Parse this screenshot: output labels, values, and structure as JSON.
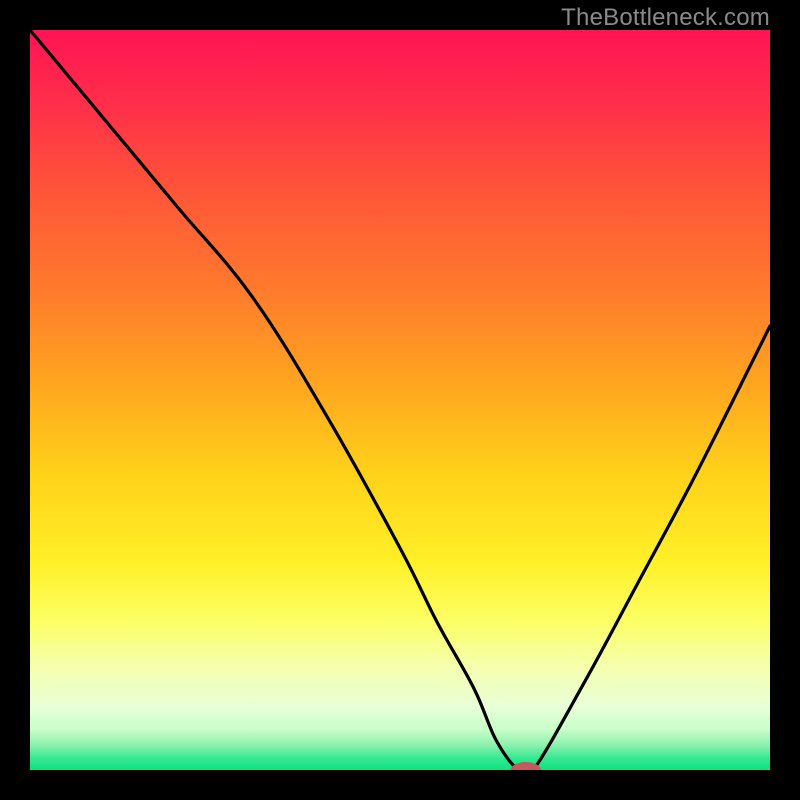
{
  "attribution": "TheBottleneck.com",
  "chart_data": {
    "type": "line",
    "title": "",
    "xlabel": "",
    "ylabel": "",
    "xlim": [
      0,
      100
    ],
    "ylim": [
      0,
      100
    ],
    "x": [
      0,
      10,
      20,
      30,
      40,
      50,
      55,
      60,
      63,
      66,
      68,
      75,
      82,
      90,
      100
    ],
    "values": [
      100,
      88,
      76,
      64,
      48,
      30,
      20,
      11,
      4,
      0,
      0,
      12,
      25,
      40,
      60
    ],
    "marker": {
      "x": 67,
      "y": 0,
      "color": "#c45a5a",
      "rx": 6,
      "ry": 4
    },
    "gradient_stops": [
      {
        "offset": 0.0,
        "color": "#ff1454"
      },
      {
        "offset": 0.1,
        "color": "#ff2e4a"
      },
      {
        "offset": 0.22,
        "color": "#ff5638"
      },
      {
        "offset": 0.35,
        "color": "#ff7a2d"
      },
      {
        "offset": 0.48,
        "color": "#ffa61f"
      },
      {
        "offset": 0.6,
        "color": "#ffd21a"
      },
      {
        "offset": 0.72,
        "color": "#fff028"
      },
      {
        "offset": 0.8,
        "color": "#fcff66"
      },
      {
        "offset": 0.86,
        "color": "#f5ffae"
      },
      {
        "offset": 0.915,
        "color": "#e8ffd8"
      },
      {
        "offset": 0.945,
        "color": "#c8ffc8"
      },
      {
        "offset": 0.965,
        "color": "#90f2b0"
      },
      {
        "offset": 0.985,
        "color": "#30e890"
      },
      {
        "offset": 1.0,
        "color": "#10e080"
      }
    ]
  }
}
